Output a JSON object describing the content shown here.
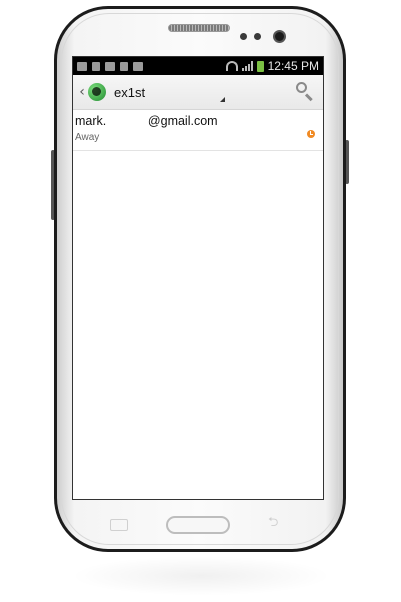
{
  "statusbar": {
    "time": "12:45 PM",
    "left_icons": [
      "notification-icon",
      "usb-icon",
      "image-icon",
      "lock-icon",
      "play-icon"
    ],
    "right_icons": [
      "wifi-icon",
      "signal-icon",
      "battery-charging-icon"
    ]
  },
  "actionbar": {
    "account": "ex1st",
    "back_icon": "chevron-left-icon",
    "app_icon": "talk-app-icon",
    "search_icon": "search-icon"
  },
  "contacts": [
    {
      "email": "mark.            @gmail.com",
      "status": "Away",
      "status_icon": "away-status-icon",
      "status_color": "#f08a24"
    }
  ],
  "colors": {
    "statusbar_bg": "#000000",
    "actionbar_bg": "#eeeeee",
    "away": "#f08a24"
  }
}
